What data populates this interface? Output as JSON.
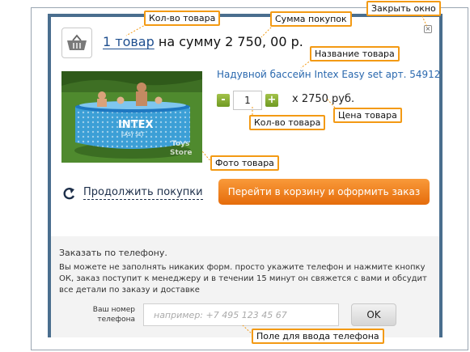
{
  "callouts": {
    "qty_top": "Кол-во товара",
    "sum": "Сумма покупок",
    "close": "Закрыть окно",
    "name": "Название товара",
    "qty_mid": "Кол-во товара",
    "price": "Цена товара",
    "photo": "Фото товара",
    "phone_field": "Поле для ввода телефона"
  },
  "summary": {
    "qty_link": "1 товар",
    "text": " на сумму 2 750, 00 р."
  },
  "close_symbol": "×",
  "product": {
    "name": "Надувной бассейн Intex Easy set арт. 54912",
    "qty": "1",
    "minus": "-",
    "plus": "+",
    "price": "х 2750 руб.",
    "photo_brand": "INTEX",
    "photo_model": "EASY SET",
    "watermark_1": "Toys",
    "watermark_2": "Store"
  },
  "actions": {
    "continue": "Продолжить покупки",
    "checkout": "Перейти в корзину и оформить заказ"
  },
  "phone": {
    "title": "Заказать по телефону.",
    "description": "Вы можете не заполнять никаких форм. просто укажите телефон и нажмите кнопку ОК, заказ поступит к менеджеру и  в течении 15 минут он свяжется с вами и обсудит все детали по заказу и доставке",
    "label": "Ваш номер телефона",
    "placeholder": "например: +7 495 123 45 67",
    "ok": "OK"
  },
  "colors": {
    "modal_border": "#4a6e8e",
    "callout_border": "#f39a14",
    "checkout_button": "#f08a24",
    "stepper_button": "#8cb33a",
    "link": "#2a68ae"
  },
  "icons": [
    "basket-icon",
    "close-icon",
    "refresh-arrow-icon"
  ]
}
